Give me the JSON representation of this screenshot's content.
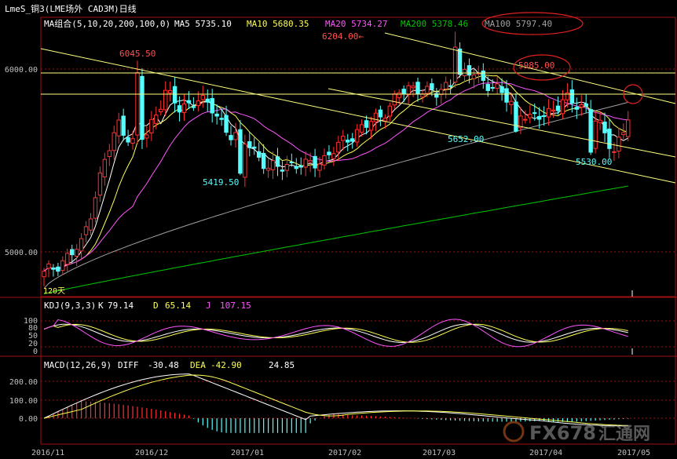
{
  "window": {
    "title": "LmeS_铜3(LME场外 CAD3M)日线"
  },
  "ma_panel": {
    "label": "MA组合(5,10,20,200,100,0)",
    "ma5": "MA5 5735.10",
    "ma10": "MA10 5680.35",
    "ma20": "MA20 5734.27",
    "ma200": "MA200 5378.46",
    "ma100": "MA100 5797.40"
  },
  "kdj_panel": {
    "label": "KDJ(9,3,3)",
    "k_label": "K",
    "k_value": "79.14",
    "d_label": "D",
    "d_value": "65.14",
    "j_label": "J",
    "j_value": "107.15"
  },
  "macd_panel": {
    "label": "MACD(12,26,9)",
    "diff_label": "DIFF",
    "diff_value": "-30.48",
    "dea_label": "DEA",
    "dea_value": "-42.90",
    "macd_value": "24.85"
  },
  "watermark": {
    "text": "FX678",
    "sub": "汇通网"
  },
  "colors": {
    "up": "#ff3030",
    "down": "#54ffff",
    "ma5": "#ffffff",
    "ma10": "#ffff54",
    "ma20": "#ff54ff",
    "ma100": "#a0a0a0",
    "ma200": "#00c800",
    "grid": "#a01010",
    "trend": "#ffff80",
    "annotation_up": "#ff5050",
    "annotation_down": "#54ffff"
  },
  "chart_data": {
    "type": "candlestick",
    "y_axis": {
      "price_ticks": [
        "6000.00",
        "5000.00"
      ],
      "kdj_ticks": [
        "100",
        "80",
        "50",
        "20",
        "0"
      ],
      "macd_ticks": [
        "200.00",
        "100.00",
        "0.00"
      ]
    },
    "x_axis": {
      "ticks": [
        "2016/11",
        "2016/12",
        "2017/01",
        "2017/02",
        "2017/03",
        "2017/04",
        "2017/05"
      ]
    },
    "annotations": [
      {
        "label": "6045.50",
        "kind": "high"
      },
      {
        "label": "6204.00←",
        "kind": "high"
      },
      {
        "label": "5985.00",
        "kind": "high"
      },
      {
        "label": "5419.50",
        "kind": "low"
      },
      {
        "label": "5652.00",
        "kind": "low"
      },
      {
        "label": "5530.00",
        "kind": "low"
      },
      {
        "label": "120天",
        "kind": "note"
      }
    ],
    "ohlc_estimate": {
      "start": 4850,
      "high_peak": 6204,
      "low_dec": 5419.5,
      "low_mar": 5652,
      "low_apr": 5530,
      "last": 5735
    }
  }
}
